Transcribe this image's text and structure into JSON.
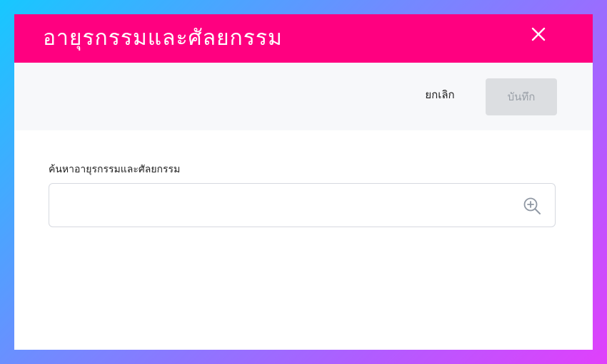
{
  "dialog": {
    "title": "อายุรกรรมและศัลยกรรม",
    "close_icon": "close-icon"
  },
  "toolbar": {
    "cancel_label": "ยกเลิก",
    "save_label": "บันทึก"
  },
  "search": {
    "label": "ค้นหาอายุรกรรมและศัลยกรรม",
    "value": "",
    "placeholder": "",
    "icon": "zoom-in-icon"
  },
  "colors": {
    "header": "#ff0080",
    "toolbar_bg": "#f7f8fa",
    "save_disabled_bg": "#dcdee1"
  }
}
